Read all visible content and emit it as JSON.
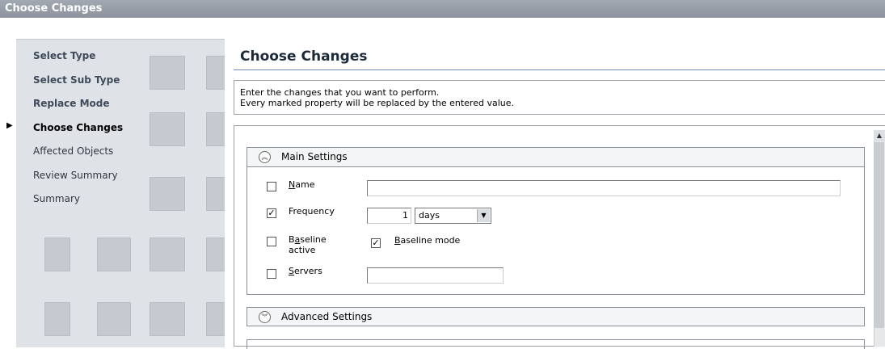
{
  "window": {
    "title": "Choose Changes"
  },
  "wizard": {
    "steps": [
      {
        "label": "Select Type",
        "state": "done"
      },
      {
        "label": "Select Sub Type",
        "state": "done"
      },
      {
        "label": "Replace Mode",
        "state": "done"
      },
      {
        "label": "Choose Changes",
        "state": "current"
      },
      {
        "label": "Affected Objects",
        "state": "future"
      },
      {
        "label": "Review Summary",
        "state": "future"
      },
      {
        "label": "Summary",
        "state": "future"
      }
    ]
  },
  "main": {
    "heading": "Choose Changes",
    "instructions": [
      "Enter the changes that you want to perform.",
      "Every marked property will be replaced by the entered value."
    ]
  },
  "main_settings": {
    "title": "Main Settings",
    "name": {
      "label_key": "N",
      "label_rest": "ame",
      "checked": false,
      "value": ""
    },
    "frequency": {
      "label": "Frequency",
      "checked": true,
      "value": "1",
      "unit": "days"
    },
    "baseline_active": {
      "label_key": "a",
      "label_pre": "B",
      "label_rest": "seline",
      "label_line2": "active",
      "checked": false
    },
    "baseline_mode": {
      "label_key": "B",
      "label_rest": "aseline mode",
      "checked": true
    },
    "servers": {
      "label_key": "S",
      "label_rest": "ervers",
      "checked": false,
      "value": ""
    }
  },
  "advanced_settings": {
    "title": "Advanced Settings"
  },
  "colors": {
    "titlebar": "#8d939d",
    "accent_rule": "#6d8fb5",
    "sidebar": "#dfe3e8"
  }
}
